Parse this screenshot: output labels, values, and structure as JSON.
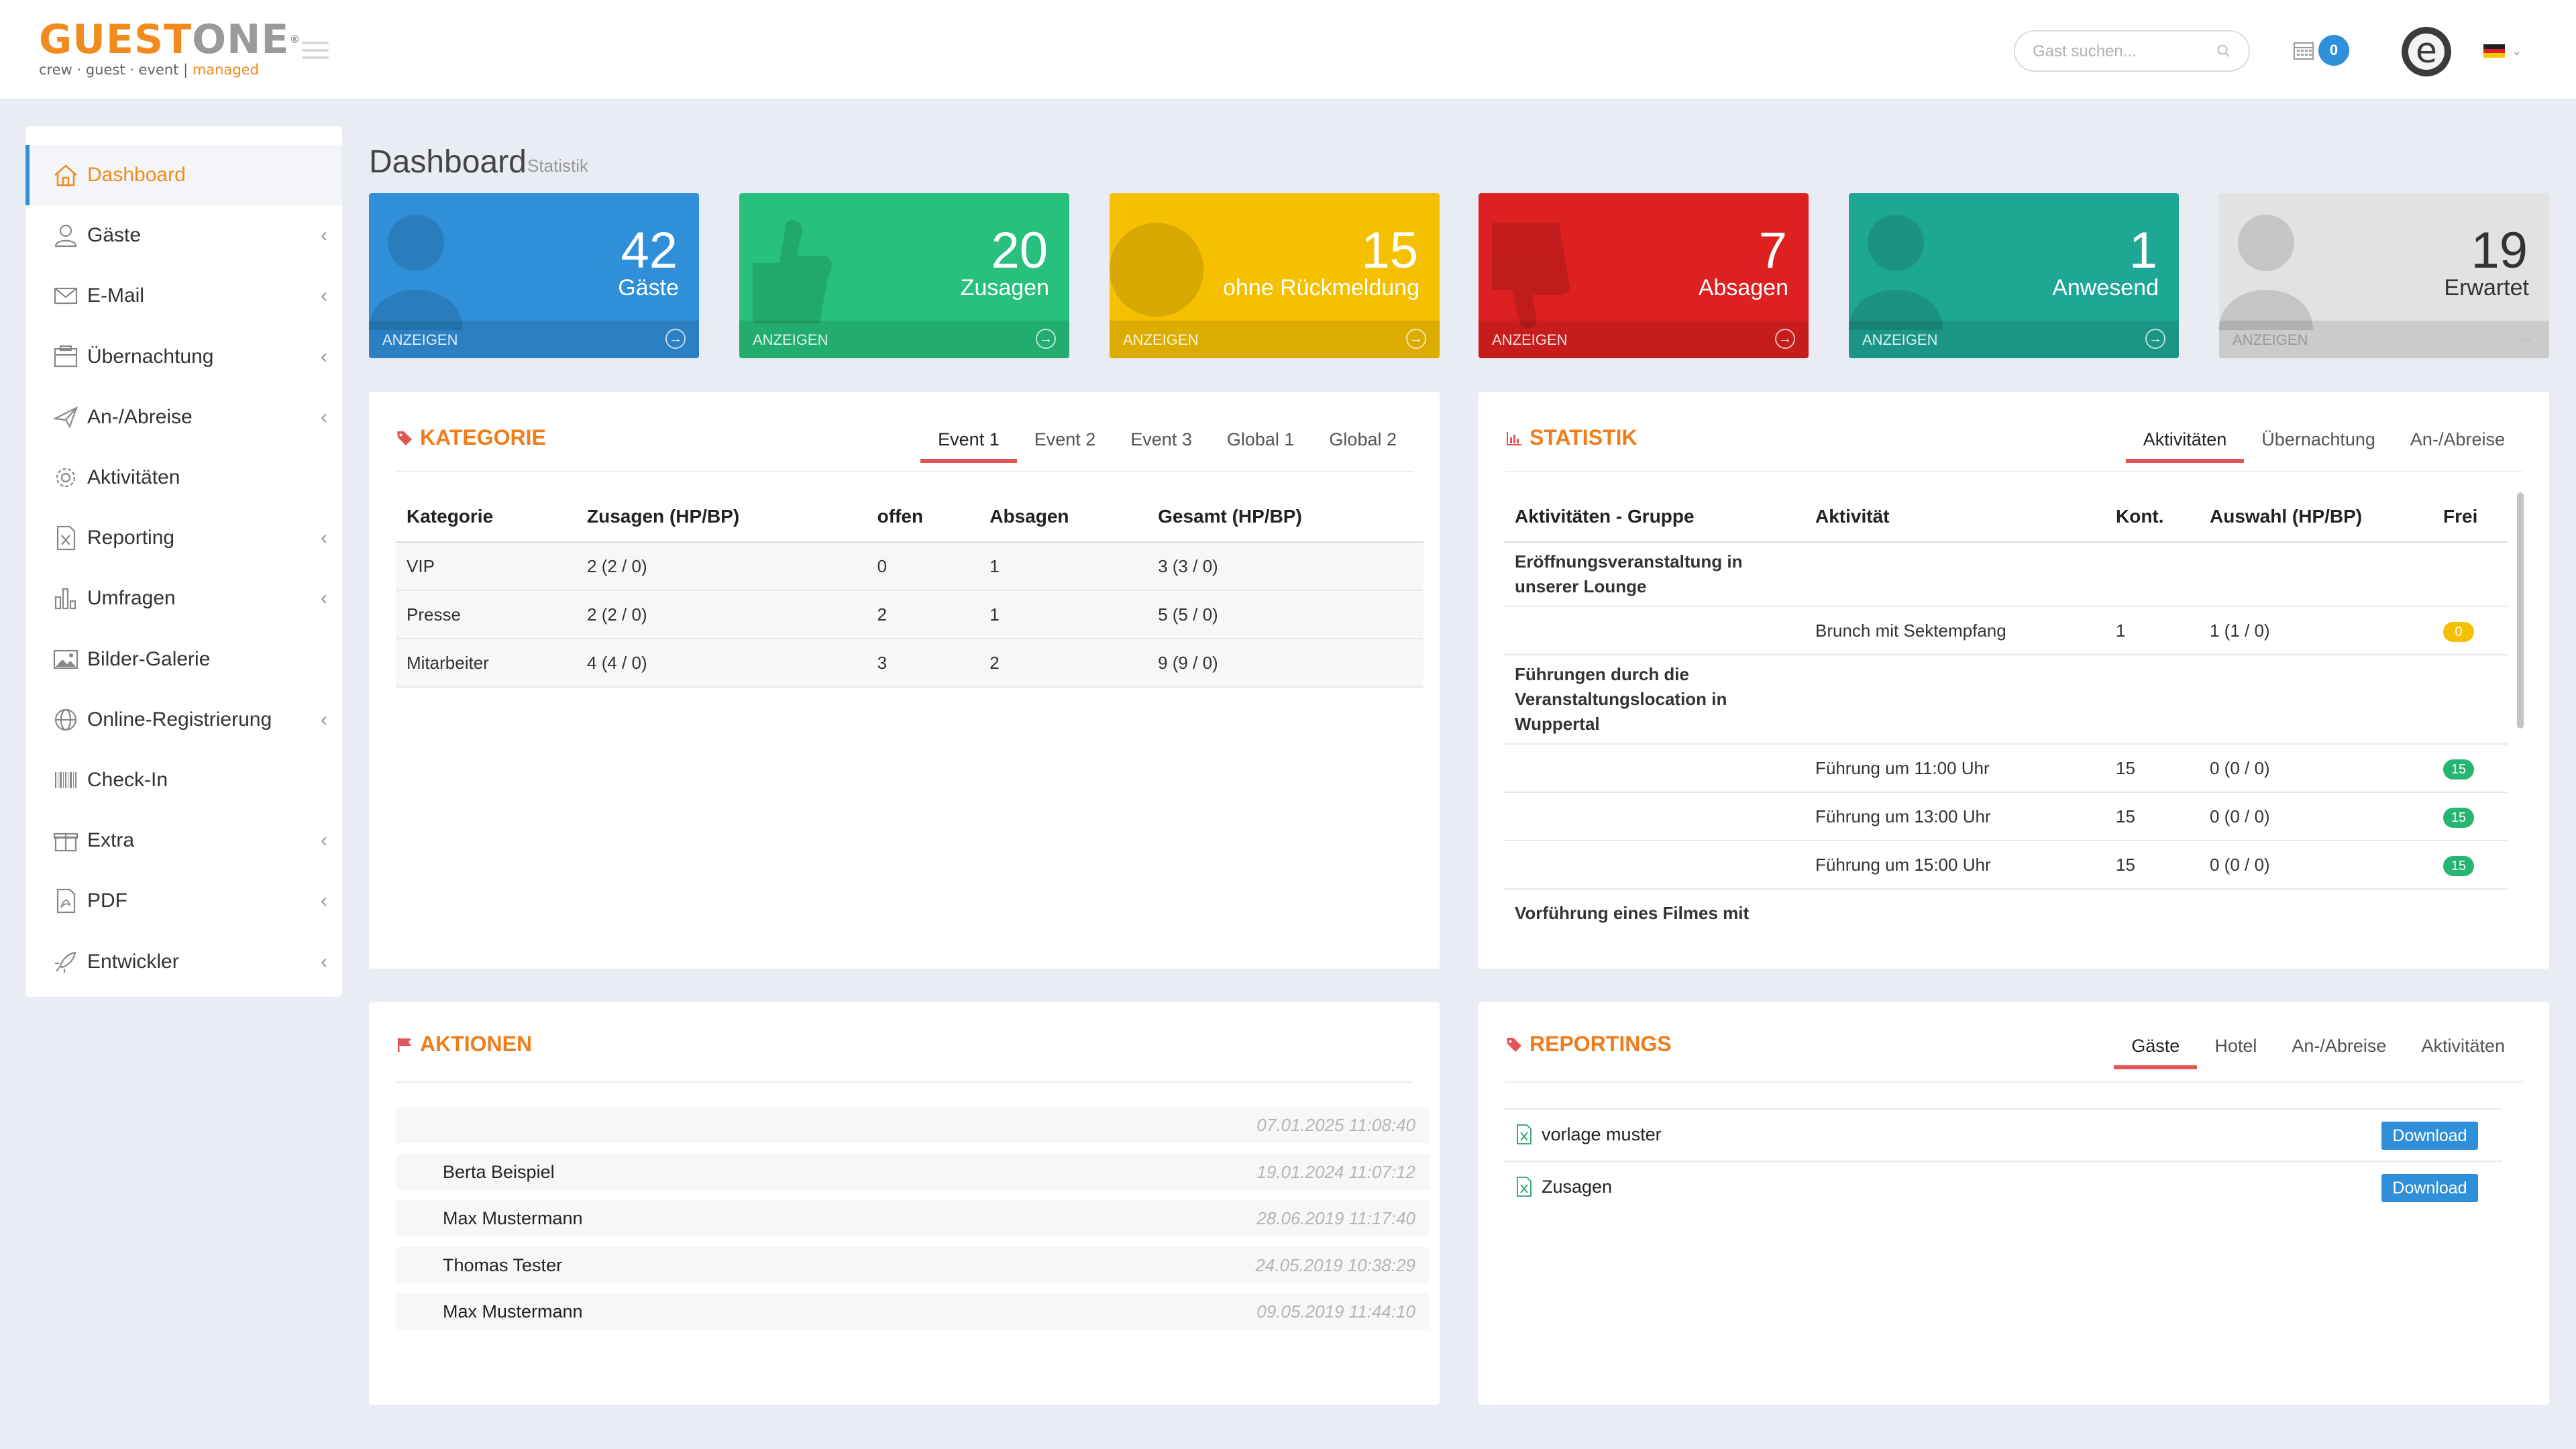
{
  "app": {
    "logo_text_orange": "GUEST",
    "logo_text_grey": "ONE",
    "logo_reg": "®",
    "logo_tagline": "crew · guest · event | ",
    "logo_tagline_accent": "managed"
  },
  "header": {
    "search_placeholder": "Gast suchen...",
    "calendar_count": "0",
    "avatar_letter": "e",
    "language_flag": "de"
  },
  "sidebar": {
    "items": [
      {
        "label": "Dashboard",
        "icon": "home-icon",
        "chevron": false,
        "active": true
      },
      {
        "label": "Gäste",
        "icon": "user-icon",
        "chevron": true
      },
      {
        "label": "E-Mail",
        "icon": "envelope-icon",
        "chevron": true
      },
      {
        "label": "Übernachtung",
        "icon": "hotel-icon",
        "chevron": true
      },
      {
        "label": "An-/Abreise",
        "icon": "plane-icon",
        "chevron": true
      },
      {
        "label": "Aktivitäten",
        "icon": "gear-icon",
        "chevron": false
      },
      {
        "label": "Reporting",
        "icon": "excel-file-icon",
        "chevron": true
      },
      {
        "label": "Umfragen",
        "icon": "bar-chart-icon",
        "chevron": true
      },
      {
        "label": "Bilder-Galerie",
        "icon": "image-icon",
        "chevron": false
      },
      {
        "label": "Online-Registrierung",
        "icon": "globe-icon",
        "chevron": true
      },
      {
        "label": "Check-In",
        "icon": "barcode-icon",
        "chevron": false
      },
      {
        "label": "Extra",
        "icon": "gift-icon",
        "chevron": true
      },
      {
        "label": "PDF",
        "icon": "pdf-file-icon",
        "chevron": true
      },
      {
        "label": "Entwickler",
        "icon": "rocket-icon",
        "chevron": true
      }
    ],
    "chevron_glyph": "‹"
  },
  "page": {
    "title": "Dashboard",
    "subtitle": "Statistik"
  },
  "tiles": [
    {
      "value": "42",
      "label": "Gäste",
      "link": "ANZEIGEN",
      "color": "#2f8fd8",
      "icon": "user-icon"
    },
    {
      "value": "20",
      "label": "Zusagen",
      "link": "ANZEIGEN",
      "color": "#27c07d",
      "icon": "thumbs-up-icon"
    },
    {
      "value": "15",
      "label": "ohne Rückmeldung",
      "link": "ANZEIGEN",
      "color": "#f5c000",
      "icon": "question-icon"
    },
    {
      "value": "7",
      "label": "Absagen",
      "link": "ANZEIGEN",
      "color": "#dd2020",
      "icon": "thumbs-down-icon"
    },
    {
      "value": "1",
      "label": "Anwesend",
      "link": "ANZEIGEN",
      "color": "#1fa796",
      "icon": "user-icon"
    },
    {
      "value": "19",
      "label": "Erwartet",
      "link": "ANZEIGEN",
      "color": "#e2e2e2",
      "icon": "user-icon"
    }
  ],
  "kategorie": {
    "title": "KATEGORIE",
    "tabs": [
      "Event 1",
      "Event 2",
      "Event 3",
      "Global 1",
      "Global 2"
    ],
    "active_tab": 0,
    "columns": [
      "Kategorie",
      "Zusagen (HP/BP)",
      "offen",
      "Absagen",
      "Gesamt (HP/BP)"
    ],
    "rows": [
      [
        "VIP",
        "2 (2 / 0)",
        "0",
        "1",
        "3 (3 / 0)"
      ],
      [
        "Presse",
        "2 (2 / 0)",
        "2",
        "1",
        "5 (5 / 0)"
      ],
      [
        "Mitarbeiter",
        "4 (4 / 0)",
        "3",
        "2",
        "9 (9 / 0)"
      ]
    ]
  },
  "statistik": {
    "title": "STATISTIK",
    "tabs": [
      "Aktivitäten",
      "Übernachtung",
      "An-/Abreise"
    ],
    "active_tab": 0,
    "columns": [
      "Aktivitäten - Gruppe",
      "Aktivität",
      "Kont.",
      "Auswahl (HP/BP)",
      "Frei"
    ],
    "group1": "Eröffnungsveranstaltung in unserer Lounge",
    "group1_rows": [
      {
        "activity": "Brunch mit Sektempfang",
        "kont": "1",
        "auswahl": "1 (1 / 0)",
        "frei": "0",
        "frei_color": "#f5c000"
      }
    ],
    "group2": "Führungen durch die Veranstaltungslocation in Wuppertal",
    "group2_rows": [
      {
        "activity": "Führung um 11:00 Uhr",
        "kont": "15",
        "auswahl": "0 (0 / 0)",
        "frei": "15",
        "frei_color": "#27b573"
      },
      {
        "activity": "Führung um 13:00 Uhr",
        "kont": "15",
        "auswahl": "0 (0 / 0)",
        "frei": "15",
        "frei_color": "#27b573"
      },
      {
        "activity": "Führung um 15:00 Uhr",
        "kont": "15",
        "auswahl": "0 (0 / 0)",
        "frei": "15",
        "frei_color": "#27b573"
      }
    ],
    "group3": "Vorführung eines Filmes mit"
  },
  "aktionen": {
    "title": "AKTIONEN",
    "rows": [
      {
        "name": "",
        "time": "07.01.2025 11:08:40"
      },
      {
        "name": "Berta Beispiel",
        "time": "19.01.2024 11:07:12"
      },
      {
        "name": "Max Mustermann",
        "time": "28.06.2019 11:17:40"
      },
      {
        "name": "Thomas Tester",
        "time": "24.05.2019 10:38:29"
      },
      {
        "name": "Max Mustermann",
        "time": "09.05.2019 11:44:10"
      }
    ]
  },
  "reportings": {
    "title": "REPORTINGS",
    "tabs": [
      "Gäste",
      "Hotel",
      "An-/Abreise",
      "Aktivitäten"
    ],
    "active_tab": 0,
    "files": [
      {
        "name": "vorlage muster",
        "button": "Download"
      },
      {
        "name": "Zusagen",
        "button": "Download"
      }
    ]
  }
}
